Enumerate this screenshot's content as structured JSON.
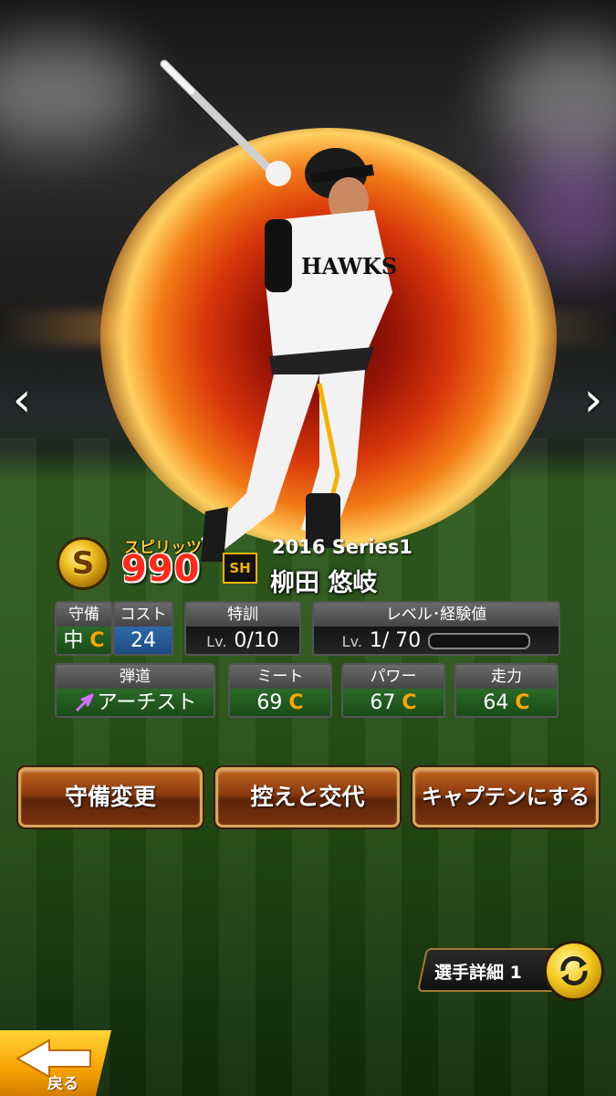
{
  "card": {
    "spirits_grade": "S",
    "spirits_label": "スピリッツ",
    "spirits_value": "990",
    "team_logo": "SH",
    "series": "2016 Series1",
    "player_name": "柳田 悠岐"
  },
  "stats_row1": {
    "position_header": "守備",
    "position_value": "中",
    "position_grade": "C",
    "cost_header": "コスト",
    "cost_value": "24",
    "training_header": "特訓",
    "training_lv": "Lv.",
    "training_value": "0/10",
    "level_header": "レベル･経験値",
    "level_lv": "Lv.",
    "level_value": "1/ 70",
    "exp_progress": 0.0
  },
  "stats_row2": {
    "trajectory_header": "弾道",
    "trajectory_value": "アーチスト",
    "meet_header": "ミート",
    "meet_value": "69",
    "meet_grade": "C",
    "power_header": "パワー",
    "power_value": "67",
    "power_grade": "C",
    "speed_header": "走力",
    "speed_value": "64",
    "speed_grade": "C"
  },
  "buttons": {
    "change_position": "守備変更",
    "swap_reserve": "控えと交代",
    "make_captain": "キャプテンにする"
  },
  "footer": {
    "player_detail": "選手詳細 1",
    "back": "戻る"
  },
  "nav": {
    "prev_glyph": "‹",
    "next_glyph": "›"
  },
  "colors": {
    "grade_c": "#ffa500",
    "spirits_red": "#ff2a1a",
    "button_brown": "#8a3a0e",
    "back_yellow": "#f5a300"
  },
  "icons": [
    "chevron-left-icon",
    "chevron-right-icon",
    "spirits-coin-icon",
    "team-logo-icon",
    "trajectory-arrow-icon",
    "refresh-icon",
    "back-arrow-icon"
  ]
}
